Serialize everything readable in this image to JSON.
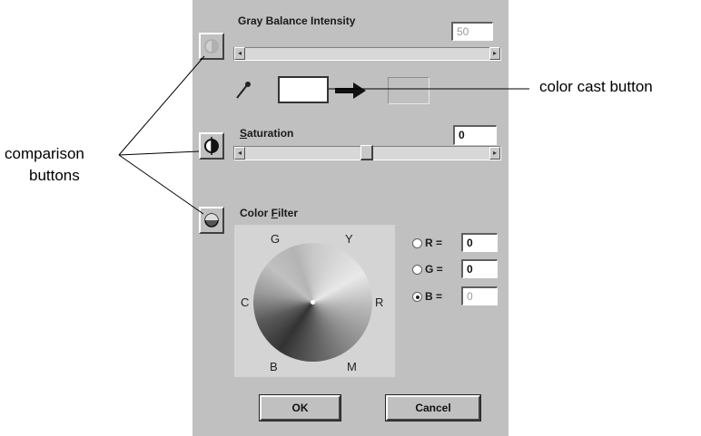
{
  "gray_balance": {
    "label": "Gray Balance Intensity",
    "value": "50"
  },
  "saturation": {
    "label": "Saturation",
    "value": "0",
    "level": 0.5
  },
  "color_filter": {
    "label": "Color Filter",
    "wheel_letters": [
      "G",
      "Y",
      "C",
      "R",
      "B",
      "M"
    ],
    "channels": [
      {
        "label": "R =",
        "value": "0",
        "selected": false
      },
      {
        "label": "G =",
        "value": "0",
        "selected": false
      },
      {
        "label": "B =",
        "value": "0",
        "selected": true
      }
    ]
  },
  "buttons": {
    "ok": "OK",
    "cancel": "Cancel"
  },
  "callouts": {
    "color_cast": "color cast button",
    "comparison_line1": "comparison",
    "comparison_line2": "buttons"
  },
  "icons": {
    "gray_balance_compare": "half-circle-icon",
    "saturation_compare": "half-circle-icon",
    "color_filter_compare": "half-circle-icon",
    "eyedropper": "eyedropper-icon",
    "arrow": "arrow-right-icon"
  },
  "colors": {
    "dialog_bg": "#c0c0c0",
    "line": "#000000"
  }
}
